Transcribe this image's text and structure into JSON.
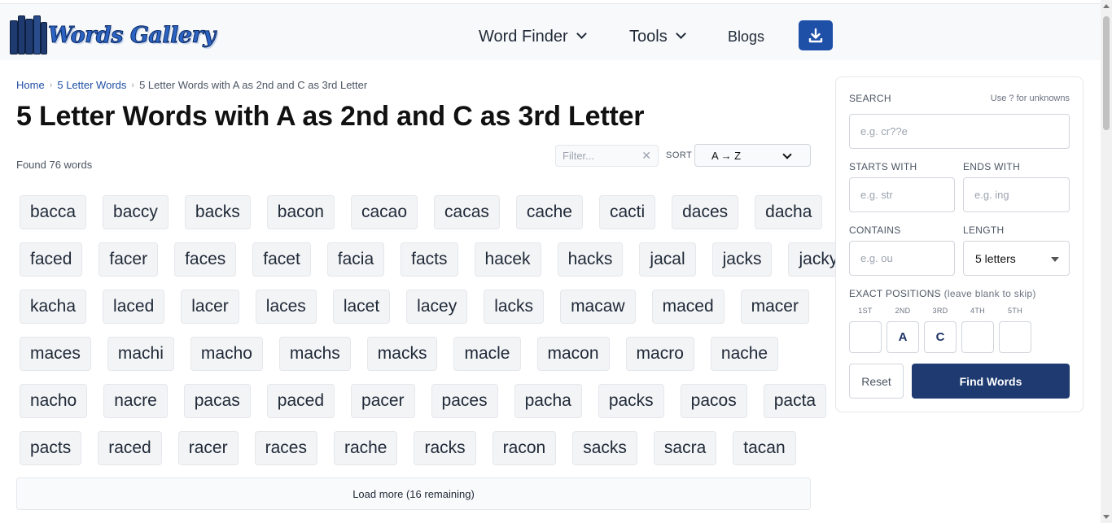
{
  "header": {
    "logo_text": "Words Gallery",
    "nav": {
      "word_finder": "Word Finder",
      "tools": "Tools",
      "blogs": "Blogs"
    },
    "download_icon": "download-icon",
    "accent_color": "#1e50a8"
  },
  "breadcrumb": {
    "home": "Home",
    "level1": "5 Letter Words",
    "current": "5 Letter Words with A as 2nd and C as 3rd Letter"
  },
  "page": {
    "title": "5 Letter Words with A as 2nd and C as 3rd Letter",
    "found_text": "Found 76 words",
    "filter_placeholder": "Filter...",
    "sort_label": "SORT",
    "sort_value": "A → Z"
  },
  "words": [
    [
      "bacca",
      "baccy",
      "backs",
      "bacon",
      "cacao",
      "cacas",
      "cache",
      "cacti",
      "daces",
      "dacha"
    ],
    [
      "faced",
      "facer",
      "faces",
      "facet",
      "facia",
      "facts",
      "hacek",
      "hacks",
      "jacal",
      "jacks",
      "jacky"
    ],
    [
      "kacha",
      "laced",
      "lacer",
      "laces",
      "lacet",
      "lacey",
      "lacks",
      "macaw",
      "maced",
      "macer"
    ],
    [
      "maces",
      "machi",
      "macho",
      "machs",
      "macks",
      "macle",
      "macon",
      "macro",
      "nache"
    ],
    [
      "nacho",
      "nacre",
      "pacas",
      "paced",
      "pacer",
      "paces",
      "pacha",
      "packs",
      "pacos",
      "pacta"
    ],
    [
      "pacts",
      "raced",
      "racer",
      "races",
      "rache",
      "racks",
      "racon",
      "sacks",
      "sacra",
      "tacan"
    ]
  ],
  "load_more": "Load more (16 remaining)",
  "sidebar": {
    "search_label": "SEARCH",
    "search_hint": "Use ? for unknowns",
    "search_placeholder": "e.g. cr??e",
    "starts_label": "STARTS WITH",
    "starts_placeholder": "e.g. str",
    "ends_label": "ENDS WITH",
    "ends_placeholder": "e.g. ing",
    "contains_label": "CONTAINS",
    "contains_placeholder": "e.g. ou",
    "length_label": "LENGTH",
    "length_value": "5 letters",
    "positions_label": "EXACT POSITIONS",
    "positions_hint": "(leave blank to skip)",
    "positions": [
      {
        "label": "1ST",
        "value": ""
      },
      {
        "label": "2ND",
        "value": "A"
      },
      {
        "label": "3RD",
        "value": "C"
      },
      {
        "label": "4TH",
        "value": ""
      },
      {
        "label": "5TH",
        "value": ""
      }
    ],
    "reset_label": "Reset",
    "find_label": "Find Words",
    "find_color": "#1e3a70"
  }
}
